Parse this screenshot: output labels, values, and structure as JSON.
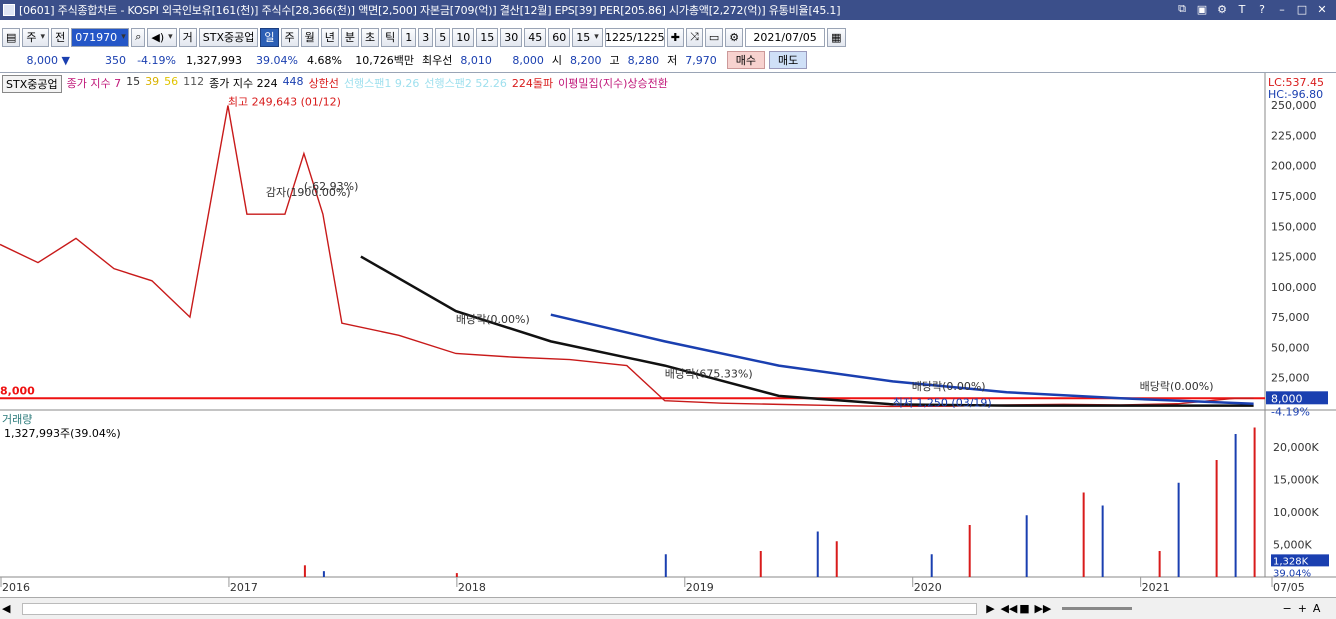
{
  "window": {
    "title": "[0601] 주식종합차트 - KOSPI 외국인보유[161(천)] 주식수[28,366(천)] 액면[2,500] 자본금[709(억)] 결산[12월] EPS[39] PER[205.86] 시가총액[2,272(억)] 유통비율[45.1]"
  },
  "toolbar": {
    "type_label": "주",
    "type_label2": "전",
    "code": "071970",
    "volume_icon": "speaker-icon",
    "trade_label": "거",
    "stock_name": "STX중공업",
    "period_buttons": [
      "일",
      "주",
      "월",
      "년",
      "분",
      "초",
      "틱"
    ],
    "interval_buttons": [
      "1",
      "3",
      "5",
      "10",
      "15",
      "30",
      "45",
      "60"
    ],
    "interval_value": "15",
    "pager": "1225/1225",
    "date": "2021/07/05"
  },
  "price": {
    "current": "8,000 ▼",
    "change": "350",
    "rate": "-4.19%",
    "volume": "1,327,993",
    "vol_rate": "39.04%",
    "turnover": "4.68%",
    "amount": "10,726백만",
    "best_label": "최우선",
    "best_ask": "8,010",
    "best_bid": "8,000",
    "open_label": "시",
    "open": "8,200",
    "high_label": "고",
    "high": "8,280",
    "low_label": "저",
    "low": "7,970",
    "buy": "매수",
    "sell": "매도"
  },
  "legend": {
    "name": "STX중공업",
    "ma_label": "종가 지수 7",
    "ma15": "15",
    "ma39": "39",
    "ma56": "56",
    "ma112": "112",
    "ma2_label": "종가 지수 224",
    "ma448": "448",
    "upper": "상한선",
    "cloud1": "선행스팬1 9.26",
    "cloud2": "선행스팬2 52.26",
    "break224": "224돌파",
    "ma_conv": "이평밀집(지수)상승전환"
  },
  "chart_data": {
    "type": "line",
    "title": "STX중공업",
    "x_ticks": [
      "2016",
      "2017",
      "2018",
      "2019",
      "2020",
      "2021",
      "07/05"
    ],
    "y_ticks": [
      250000,
      225000,
      200000,
      175000,
      150000,
      125000,
      100000,
      75000,
      50000,
      25000
    ],
    "y_tick_labels": [
      "250,000",
      "225,000",
      "200,000",
      "175,000",
      "150,000",
      "125,000",
      "100,000",
      "75,000",
      "50,000",
      "25,000"
    ],
    "ylim": [
      0,
      260000
    ],
    "price_series": {
      "name": "종가",
      "x": [
        "2016-01",
        "2016-03",
        "2016-05",
        "2016-07",
        "2016-09",
        "2016-11",
        "2017-01",
        "2017-02",
        "2017-03",
        "2017-04",
        "2017-05",
        "2017-06",
        "2017-07",
        "2017-10",
        "2018-01",
        "2018-04",
        "2018-07",
        "2018-10",
        "2018-12",
        "2019-03",
        "2019-06",
        "2019-09",
        "2019-12",
        "2020-03",
        "2020-06",
        "2020-09",
        "2020-12",
        "2021-03",
        "2021-06",
        "2021-07"
      ],
      "values": [
        135000,
        120000,
        140000,
        115000,
        105000,
        75000,
        249643,
        160000,
        160000,
        160000,
        210000,
        160000,
        70000,
        60000,
        45000,
        42000,
        40000,
        35000,
        6000,
        4000,
        3000,
        2000,
        1250,
        1500,
        2500,
        3000,
        2500,
        3500,
        8000,
        8000
      ]
    },
    "ma224": {
      "name": "224",
      "x": [
        "2017-08",
        "2018-01",
        "2018-06",
        "2018-12",
        "2019-06",
        "2019-12",
        "2020-06",
        "2021-07"
      ],
      "values": [
        125000,
        80000,
        55000,
        35000,
        10000,
        3000,
        2000,
        2000
      ]
    },
    "ma448": {
      "name": "448",
      "x": [
        "2018-06",
        "2018-12",
        "2019-06",
        "2019-12",
        "2020-06",
        "2020-12",
        "2021-07"
      ],
      "values": [
        77000,
        55000,
        35000,
        22000,
        13000,
        8000,
        3500
      ]
    },
    "annotations": [
      {
        "text": "최고 249,643 (01/12)",
        "x": "2017-01",
        "y": 249643
      },
      {
        "text": "감자(1900.00%)",
        "x": "2017-03",
        "y": 175000
      },
      {
        "text": "(-62.93%)",
        "x": "2017-05",
        "y": 180000
      },
      {
        "text": "배당락(0.00%)",
        "x": "2018-01",
        "y": 70000
      },
      {
        "text": "배당락(675.33%)",
        "x": "2018-12",
        "y": 25000
      },
      {
        "text": "배당락(0.00%)",
        "x": "2020-01",
        "y": 15000
      },
      {
        "text": "배당락(0.00%)",
        "x": "2021-01",
        "y": 15000
      },
      {
        "text": "최저 1,250 (03/19)",
        "x": "2019-12",
        "y": 1250
      }
    ],
    "right_labels": {
      "lc": "LC:537.45",
      "hc": "HC:-96.80",
      "last": "8,000",
      "last_rate": "-4.19%"
    },
    "left_label": "8,000",
    "volume": {
      "title": "거래량",
      "info": "1,327,993주(39.04%)",
      "y_ticks": [
        20000,
        15000,
        10000,
        5000
      ],
      "y_tick_labels": [
        "20,000K",
        "15,000K",
        "10,000K",
        "5,000K"
      ],
      "ylim": [
        0,
        24000
      ],
      "last_label": "1,328K",
      "last_rate": "39.04%",
      "spikes": [
        {
          "x": "2017-05",
          "v": 1800
        },
        {
          "x": "2017-06",
          "v": 900
        },
        {
          "x": "2018-01",
          "v": 600
        },
        {
          "x": "2018-12",
          "v": 3500
        },
        {
          "x": "2019-05",
          "v": 4000
        },
        {
          "x": "2019-08",
          "v": 7000
        },
        {
          "x": "2019-09",
          "v": 5500
        },
        {
          "x": "2020-02",
          "v": 3500
        },
        {
          "x": "2020-04",
          "v": 8000
        },
        {
          "x": "2020-07",
          "v": 9500
        },
        {
          "x": "2020-10",
          "v": 13000
        },
        {
          "x": "2020-11",
          "v": 11000
        },
        {
          "x": "2021-02",
          "v": 4000
        },
        {
          "x": "2021-03",
          "v": 14500
        },
        {
          "x": "2021-05",
          "v": 18000
        },
        {
          "x": "2021-06",
          "v": 22000
        },
        {
          "x": "2021-07",
          "v": 23000
        }
      ]
    }
  },
  "status": {
    "ctrl_icons": [
      "play-icon",
      "rewind-icon",
      "stop-icon",
      "forward-icon"
    ]
  }
}
